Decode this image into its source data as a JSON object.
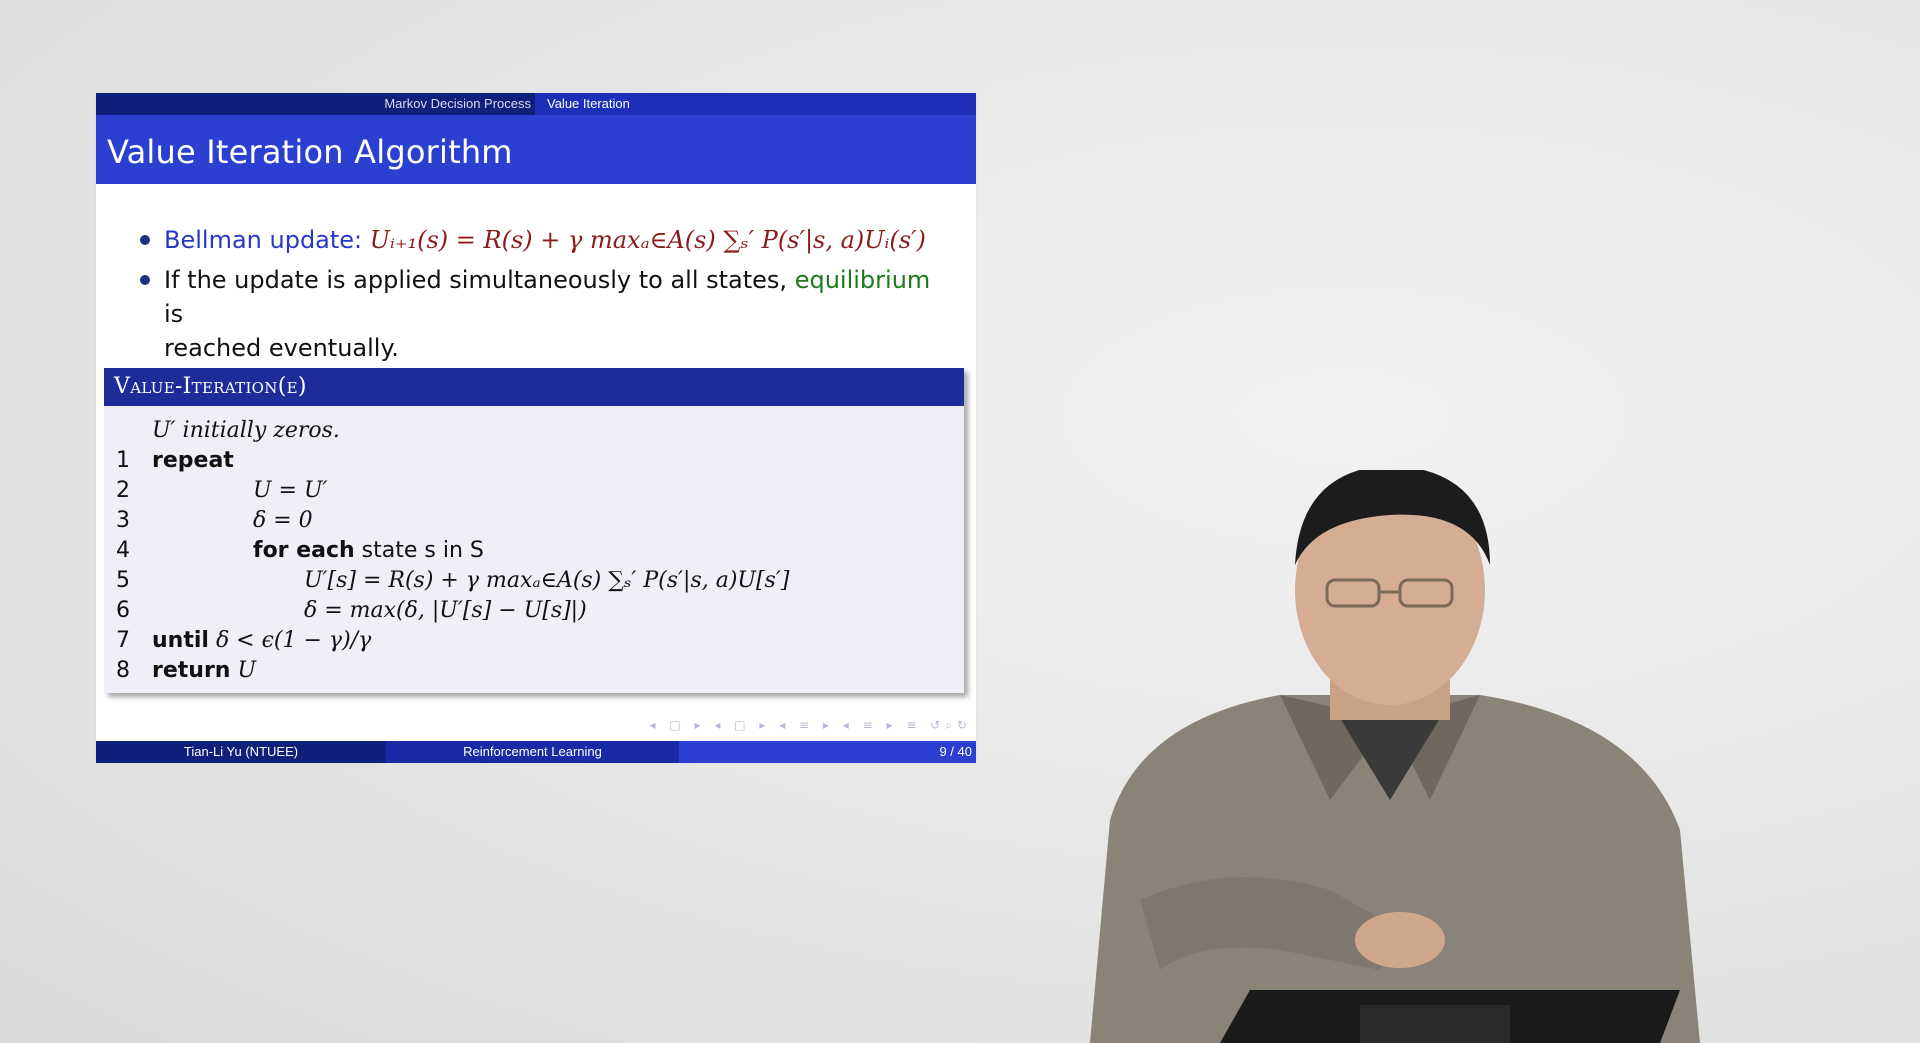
{
  "slide": {
    "nav": {
      "section": "Markov Decision Process",
      "subsection": "Value Iteration"
    },
    "title": "Value Iteration Algorithm",
    "bullets": {
      "b1_label": "Bellman update:",
      "b1_formula": "Uᵢ₊₁(s) = R(s) + γ maxₐ∈A(s) ∑ₛ′ P(s′|s, a)Uᵢ(s′)",
      "b2_prefix": "If the update is applied simultaneously to all states,",
      "b2_highlight": "equilibrium",
      "b2_suffix": "is",
      "b2_line2": "reached eventually."
    },
    "algorithm": {
      "header": "Value-Iteration(ϵ)",
      "lines": [
        {
          "num": "",
          "pre_kw": "",
          "rest": "U′ initially zeros."
        },
        {
          "num": "1",
          "pre_kw": "repeat",
          "rest": ""
        },
        {
          "num": "2",
          "pre_kw": "",
          "rest": "U = U′"
        },
        {
          "num": "3",
          "pre_kw": "",
          "rest": "δ = 0"
        },
        {
          "num": "4",
          "pre_kw": "for each",
          "rest": "state s in S"
        },
        {
          "num": "5",
          "pre_kw": "",
          "rest": "U′[s] = R(s) + γ maxₐ∈A(s) ∑ₛ′ P(s′|s, a)U[s′]"
        },
        {
          "num": "6",
          "pre_kw": "",
          "rest": "δ = max(δ, |U′[s] − U[s]|)"
        },
        {
          "num": "7",
          "pre_kw": "until",
          "rest": "δ < ϵ(1 − γ)/γ"
        },
        {
          "num": "8",
          "pre_kw": "return",
          "rest": "U"
        }
      ]
    },
    "footer": {
      "author": "Tian-Li Yu  (NTUEE)",
      "course": "Reinforcement Learning",
      "page": "9 / 40"
    },
    "nav_symbols": "◂ □ ▸ ◂ □ ▸ ◂ ≡ ▸ ◂ ≡ ▸ ≡ ↺⌕↻"
  },
  "colors": {
    "headline_dark": "#0f1f7a",
    "title_blue": "#2b3fd0",
    "box_header": "#1e2c99",
    "box_body": "#eeeff7",
    "formula_red": "#8b1a1a",
    "highlight_blue": "#2738c7",
    "highlight_green": "#1e7a1e"
  }
}
